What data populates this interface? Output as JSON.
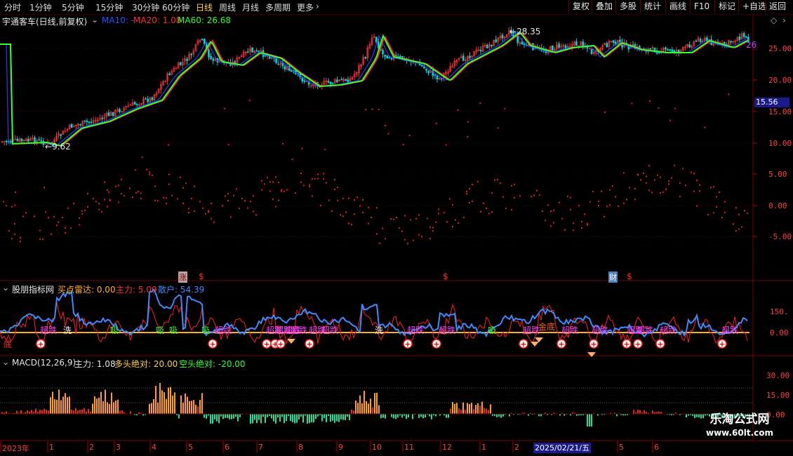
{
  "toolbar": {
    "periods": [
      "分时",
      "1分钟",
      "5分钟",
      "15分钟",
      "30分钟",
      "60分钟",
      "日线",
      "周线",
      "月线",
      "多周期",
      "更多"
    ],
    "active_period": "日线",
    "more_icon": "chevron-right-icon",
    "right_buttons": [
      "复权",
      "叠加",
      "多股",
      "统计",
      "画线",
      "F10",
      "标记",
      "+自选",
      "返回"
    ]
  },
  "main_chart": {
    "stock_title": "宇通客车(日线,前复权)",
    "ma10_label": "MA10: -",
    "ma20_label": "MA20: 1.08",
    "ma60_label": "MA60: 26.68",
    "high_marker": "28.35",
    "low_marker": "9.62",
    "right_edge_value": "26",
    "current_price": "15.56",
    "y_ticks": [
      "25.00",
      "20.00",
      "15.00",
      "10.00",
      "5.00",
      "0.00",
      "-5.00"
    ],
    "event_markers": [
      "涨",
      "$",
      "$",
      "财",
      "$"
    ]
  },
  "indicator1": {
    "name": "股朋指标网",
    "buy_radar_label": "买点雷达: 0.00",
    "main_force_label": "主力: 5.09",
    "retail_label": "散户: 54.39",
    "y_ticks": [
      "150.",
      "0.00"
    ],
    "signals": [
      "底",
      "超跌",
      "洗",
      "吸",
      "吸",
      "吸",
      "吸",
      "超跌",
      "超跌",
      "超跌",
      "超跌",
      "超跌",
      "超跌",
      "超跌",
      "洗",
      "超跌",
      "超跌",
      "吸",
      "超跌",
      "金底",
      "超跌",
      "超跌",
      "超跌",
      "超跌",
      "超跌",
      "超跌"
    ]
  },
  "macd": {
    "name": "MACD(12,26,9)",
    "main_force_label": "主力: 1.08",
    "long_label": "多头绝对: 20.00",
    "short_label": "空头绝对: -20.00",
    "y_ticks": [
      "30.00",
      "15.00",
      "0.00"
    ]
  },
  "time_axis": {
    "labels": [
      "2023年",
      "1",
      "2",
      "3",
      "4",
      "5",
      "6",
      "7",
      "8",
      "9",
      "10",
      "11",
      "12",
      "1",
      "2",
      "3",
      "4",
      "5",
      "6"
    ],
    "selected_date": "2025/02/21/五"
  },
  "watermark": {
    "line1": "乐淘公式网",
    "line2": "www.60lt.com"
  },
  "colors": {
    "up": "#ff3232",
    "down": "#00e0e0",
    "ma10": "#2040ff",
    "ma20": "#ff2020",
    "ma60": "#30ff30",
    "retail": "#3a8cff",
    "accent": "#ffd24a"
  }
}
